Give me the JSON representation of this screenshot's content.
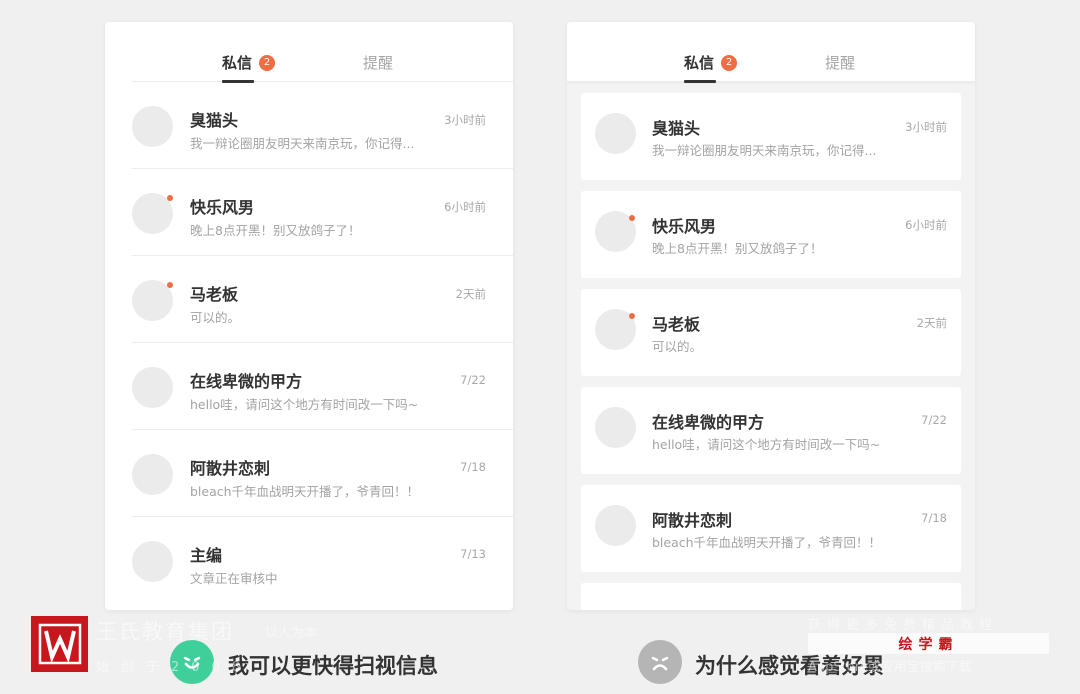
{
  "panels": [
    {
      "tabs": [
        {
          "label": "私信",
          "badge": "2"
        },
        {
          "label": "提醒"
        }
      ],
      "rows": [
        {
          "name": "臭猫头",
          "preview": "我一辩论圈朋友明天来南京玩，你记得...",
          "time": "3小时前"
        },
        {
          "name": "快乐风男",
          "preview": "晚上8点开黑！别又放鸽子了！",
          "time": "6小时前"
        },
        {
          "name": "马老板",
          "preview": "可以的。",
          "time": "2天前"
        },
        {
          "name": "在线卑微的甲方",
          "preview": "hello哇，请问这个地方有时间改一下吗~",
          "time": "7/22"
        },
        {
          "name": "阿散井恋刺",
          "preview": "bleach千年血战明天开播了，爷青回！！",
          "time": "7/18"
        },
        {
          "name": "主编",
          "preview": "文章正在审核中",
          "time": "7/13"
        }
      ]
    },
    {
      "tabs": [
        {
          "label": "私信",
          "badge": "2"
        },
        {
          "label": "提醒"
        }
      ],
      "rows": [
        {
          "name": "臭猫头",
          "preview": "我一辩论圈朋友明天来南京玩，你记得...",
          "time": "3小时前"
        },
        {
          "name": "快乐风男",
          "preview": "晚上8点开黑！别又放鸽子了！",
          "time": "6小时前"
        },
        {
          "name": "马老板",
          "preview": "可以的。",
          "time": "2天前"
        },
        {
          "name": "在线卑微的甲方",
          "preview": "hello哇，请问这个地方有时间改一下吗~",
          "time": "7/22"
        },
        {
          "name": "阿散井恋刺",
          "preview": "bleach千年血战明天开播了，爷青回！！",
          "time": "7/18"
        }
      ]
    }
  ],
  "captions": {
    "left": "我可以更快得扫视信息",
    "right": "为什么感觉看着好累"
  },
  "watermark": {
    "org": "王氏教育集团",
    "slogan": "以人为本",
    "sub": "始创于2008",
    "right_top": "获得更多免费精品教程",
    "brand": "绘学霸",
    "right_bottom": "AppStore或应用宝搜索下载"
  },
  "colors": {
    "accent": "#ef6d43",
    "happy": "#3fcf9a",
    "sad": "#b5b5b5",
    "brand_red": "#c8161d"
  },
  "icons": {
    "happy": "smile-face-icon",
    "sad": "frown-face-icon",
    "logo": "w-logo-icon"
  }
}
